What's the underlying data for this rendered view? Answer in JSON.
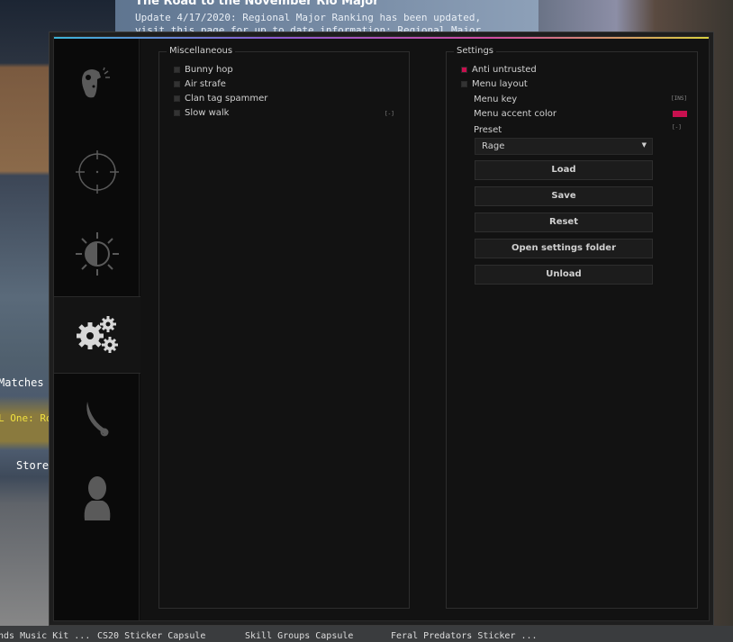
{
  "background": {
    "news_title": "The Road to the November Rio Major",
    "news_text": "Update 4/17/2020: Regional Major Ranking has been updated, visit this page for up to date information: Regional Major Ranking. Update",
    "matches": "Matches",
    "promo": "L One: Ro",
    "store": "Store",
    "bottom_items": [
      "nds Music Kit ...",
      "CS20 Sticker Capsule",
      "Skill Groups Capsule",
      "Feral Predators Sticker ..."
    ]
  },
  "sidebar": {
    "tabs": [
      {
        "icon": "ragebot-head-icon",
        "active": false
      },
      {
        "icon": "crosshair-icon",
        "active": false
      },
      {
        "icon": "visuals-brightness-icon",
        "active": false
      },
      {
        "icon": "gears-icon",
        "active": true
      },
      {
        "icon": "knife-icon",
        "active": false
      },
      {
        "icon": "user-icon",
        "active": false
      }
    ]
  },
  "misc": {
    "title": "Miscellaneous",
    "items": [
      {
        "label": "Bunny hop",
        "checked": false
      },
      {
        "label": "Air strafe",
        "checked": false
      },
      {
        "label": "Clan tag spammer",
        "checked": false
      },
      {
        "label": "Slow walk",
        "checked": false,
        "key": "[-]"
      }
    ]
  },
  "settings": {
    "title": "Settings",
    "anti_untrusted": {
      "label": "Anti untrusted",
      "checked": true
    },
    "menu_layout": {
      "label": "Menu layout",
      "checked": false
    },
    "menu_key": {
      "label": "Menu key",
      "key": "[INS]"
    },
    "accent": {
      "label": "Menu accent color",
      "color": "#c8104f"
    },
    "preset": {
      "label": "Preset",
      "key": "[-]",
      "value": "Rage"
    },
    "buttons": [
      "Load",
      "Save",
      "Reset",
      "Open settings folder",
      "Unload"
    ]
  },
  "colors": {
    "accent": "#c8104f",
    "panel": "#121212"
  }
}
